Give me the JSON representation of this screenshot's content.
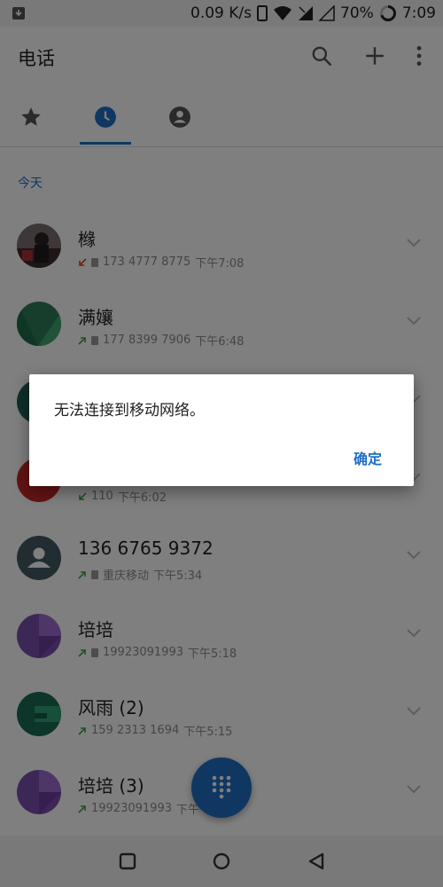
{
  "status_bar": {
    "speed": "0.09 K/s",
    "battery": "70%",
    "time": "7:09"
  },
  "app_bar": {
    "title": "电话",
    "icons": [
      "search-icon",
      "add-icon",
      "more-vert-icon"
    ]
  },
  "tabs": [
    {
      "name": "favorites",
      "icon": "star-icon"
    },
    {
      "name": "recents",
      "icon": "clock-icon",
      "active": true
    },
    {
      "name": "contacts",
      "icon": "account-icon"
    }
  ],
  "section": {
    "label": "今天"
  },
  "calls": [
    {
      "name": "橼",
      "direction": "missed",
      "number": "173 4777 8775",
      "time": "下午7:08",
      "avatar": "photo"
    },
    {
      "name": "满孃",
      "direction": "outgoing",
      "number": "177 8399 7906",
      "time": "下午6:48",
      "avatar": "green-geo"
    },
    {
      "name": "",
      "direction": "incoming",
      "number": "",
      "time": "",
      "avatar": "teal"
    },
    {
      "name": "",
      "direction": "incoming",
      "number": "110",
      "time": "下午6:02",
      "avatar": "red"
    },
    {
      "name": "136 6765 9372",
      "direction": "outgoing",
      "number": "重庆移动",
      "time": "下午5:34",
      "avatar": "default"
    },
    {
      "name": "培培",
      "direction": "outgoing",
      "number": "19923091993",
      "time": "下午5:18",
      "avatar": "purple-geo"
    },
    {
      "name": "风雨 (2)",
      "direction": "outgoing",
      "number": "159 2313 1694",
      "time": "下午5:15",
      "avatar": "teal-geo"
    },
    {
      "name": "培培 (3)",
      "direction": "outgoing",
      "number": "19923091993",
      "time": "下午",
      "avatar": "purple-geo"
    }
  ],
  "dialog": {
    "message": "无法连接到移动网络。",
    "confirm": "确定"
  },
  "colors": {
    "accent": "#1e6fc4",
    "missed": "#d84315",
    "outgoing": "#43a047"
  }
}
